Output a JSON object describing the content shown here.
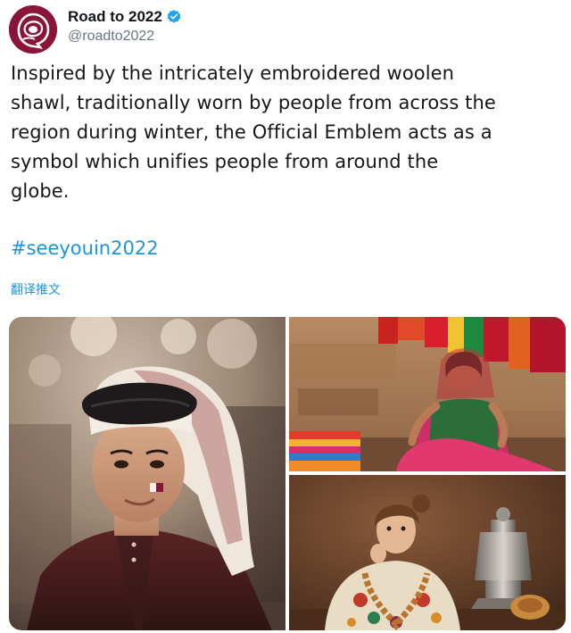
{
  "account": {
    "display_name": "Road to 2022",
    "handle": "@roadto2022",
    "avatar_icon": "qatar-2022-emblem-icon",
    "verified_icon": "verified-badge-icon",
    "brand_color": "#8a1538",
    "verified_color": "#1da1f2"
  },
  "tweet": {
    "text_lines": [
      "Inspired by the intricately embroidered woolen",
      "shawl, traditionally worn by people from across the",
      "region during winter, the Official Emblem acts as a",
      "symbol which unifies people from around the",
      "globe."
    ],
    "hashtag": "#seeyouin2022",
    "translate_label": "翻译推文",
    "link_color": "#1b95e0"
  },
  "media": {
    "photos": [
      {
        "subject": "boy-in-ghutra-photo"
      },
      {
        "subject": "woman-with-shawls-photo"
      },
      {
        "subject": "child-with-samovar-photo"
      }
    ]
  }
}
